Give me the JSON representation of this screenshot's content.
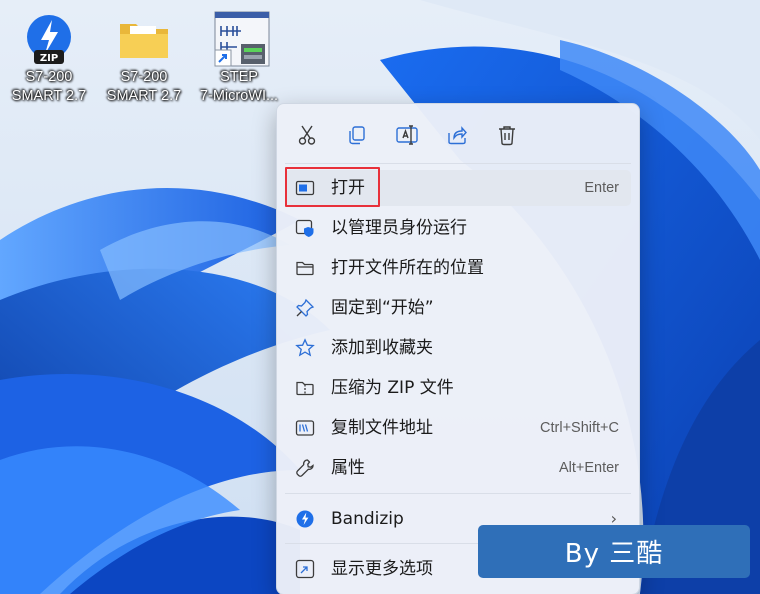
{
  "desktop_icons": [
    {
      "label_line1": "S7-200",
      "label_line2": "SMART 2.7",
      "icon": "bandizip-zip-icon",
      "badge": "ZIP"
    },
    {
      "label_line1": "S7-200",
      "label_line2": "SMART 2.7",
      "icon": "folder-icon"
    },
    {
      "label_line1": "STEP",
      "label_line2": "7-MicroWI...",
      "icon": "step7-shortcut-icon"
    }
  ],
  "quick_actions": [
    {
      "name": "cut",
      "icon": "scissors-icon"
    },
    {
      "name": "copy",
      "icon": "copy-icon"
    },
    {
      "name": "rename",
      "icon": "rename-icon"
    },
    {
      "name": "share",
      "icon": "share-icon"
    },
    {
      "name": "delete",
      "icon": "trash-icon"
    }
  ],
  "menu": {
    "open": {
      "label": "打开",
      "shortcut": "Enter",
      "icon": "open-window-icon"
    },
    "run_as_admin": {
      "label": "以管理员身份运行",
      "icon": "shield-icon"
    },
    "open_location": {
      "label": "打开文件所在的位置",
      "icon": "folder-outline-icon"
    },
    "pin_start": {
      "label": "固定到“开始”",
      "icon": "pin-icon"
    },
    "add_favorites": {
      "label": "添加到收藏夹",
      "icon": "star-icon"
    },
    "compress_zip": {
      "label": "压缩为 ZIP 文件",
      "icon": "zip-folder-icon"
    },
    "copy_path": {
      "label": "复制文件地址",
      "shortcut": "Ctrl+Shift+C",
      "icon": "copy-path-icon"
    },
    "properties": {
      "label": "属性",
      "shortcut": "Alt+Enter",
      "icon": "wrench-icon"
    },
    "bandizip": {
      "label": "Bandizip",
      "arrow": "›",
      "icon": "bandizip-icon"
    },
    "more_options": {
      "label": "显示更多选项",
      "icon": "more-options-icon"
    }
  },
  "watermark": {
    "text": "By  三酷"
  },
  "colors": {
    "accent": "#0a62d8",
    "highlight_border": "#e8303a",
    "watermark_bg": "#2f6fb8"
  }
}
